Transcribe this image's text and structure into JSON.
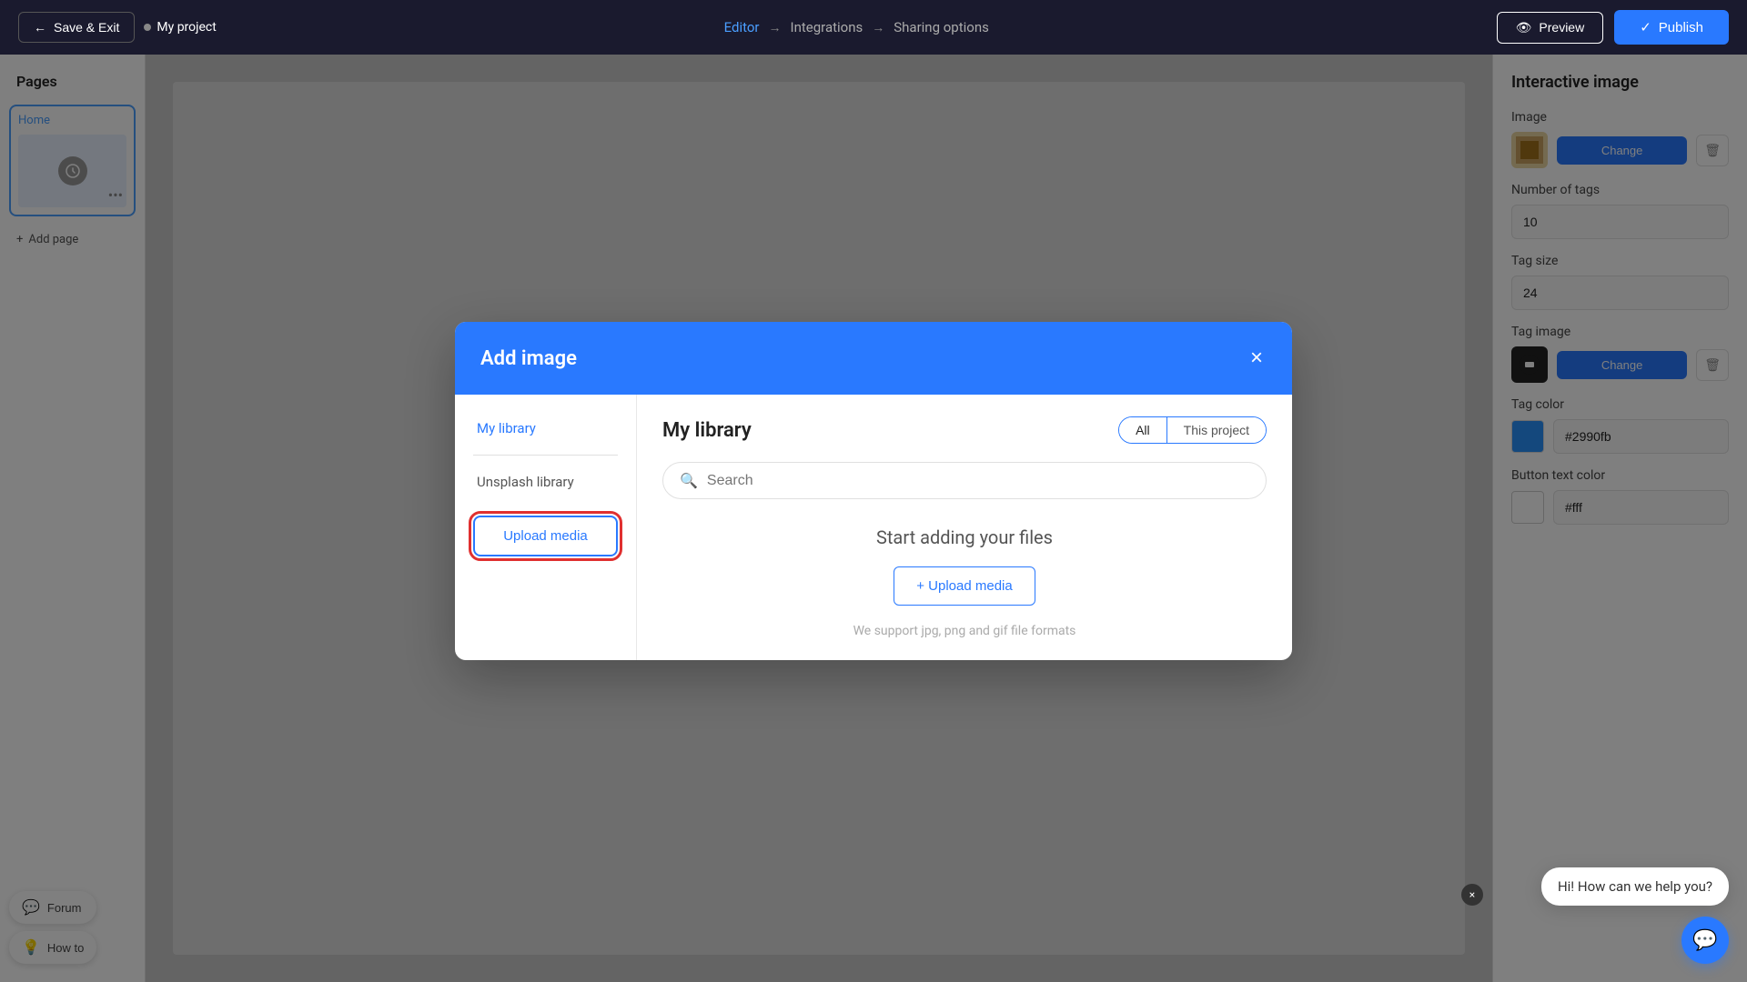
{
  "navbar": {
    "save_exit_label": "Save & Exit",
    "project_name": "My project",
    "editor_label": "Editor",
    "integrations_label": "Integrations",
    "sharing_options_label": "Sharing options",
    "preview_label": "Preview",
    "publish_label": "Publish"
  },
  "sidebar": {
    "title": "Pages",
    "home_page": "Home",
    "add_page_label": "Add page"
  },
  "right_panel": {
    "title": "Interactive image",
    "image_label": "Image",
    "change_label": "Change",
    "number_of_tags_label": "Number of tags",
    "number_of_tags_value": "10",
    "tag_size_label": "Tag size",
    "tag_size_value": "24",
    "tag_image_label": "Tag image",
    "tag_color_label": "Tag color",
    "tag_color_value": "#2990fb",
    "button_text_color_label": "Button text color",
    "button_text_color_value": "#fff"
  },
  "modal": {
    "title": "Add image",
    "close_icon": "×",
    "nav": {
      "my_library": "My library",
      "unsplash_library": "Unsplash library",
      "upload_media": "Upload media"
    },
    "content": {
      "title": "My library",
      "filter_all": "All",
      "filter_this_project": "This project",
      "search_placeholder": "Search",
      "empty_title": "Start adding your files",
      "upload_btn": "+ Upload media",
      "support_text": "We support jpg, png and gif file formats"
    }
  },
  "chat": {
    "message": "Hi! How can we help you?"
  },
  "tools": {
    "forum": "Forum",
    "how_to": "How to"
  }
}
